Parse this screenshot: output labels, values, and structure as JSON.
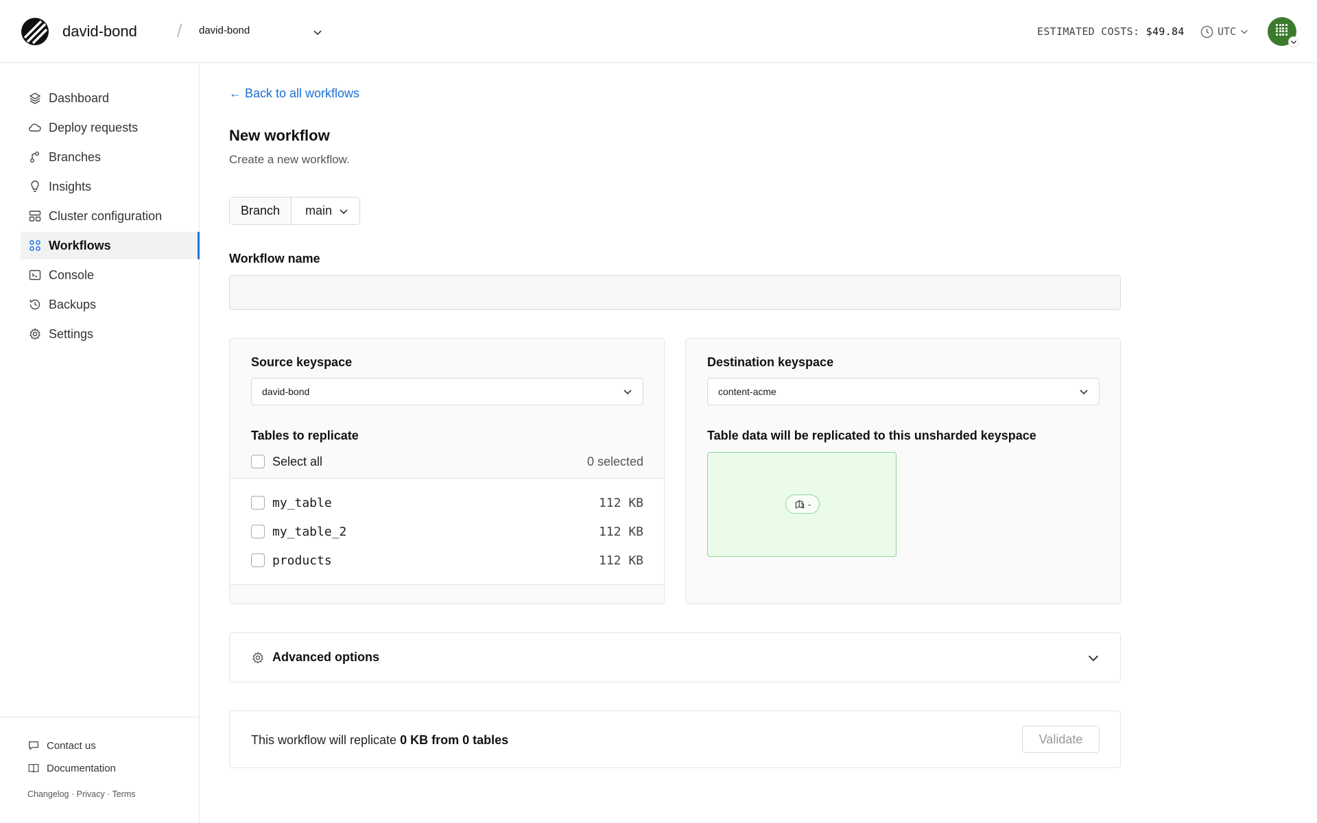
{
  "header": {
    "org_name": "david-bond",
    "database": "david-bond",
    "costs_label": "ESTIMATED COSTS:",
    "costs_value": "$49.84",
    "timezone": "UTC"
  },
  "sidebar": {
    "items": [
      {
        "label": "Dashboard",
        "icon": "layers-icon"
      },
      {
        "label": "Deploy requests",
        "icon": "cloud-icon"
      },
      {
        "label": "Branches",
        "icon": "branch-icon"
      },
      {
        "label": "Insights",
        "icon": "lightbulb-icon"
      },
      {
        "label": "Cluster configuration",
        "icon": "cluster-icon"
      },
      {
        "label": "Workflows",
        "icon": "workflows-icon",
        "active": true
      },
      {
        "label": "Console",
        "icon": "terminal-icon"
      },
      {
        "label": "Backups",
        "icon": "history-icon"
      },
      {
        "label": "Settings",
        "icon": "gear-icon"
      }
    ],
    "footer": {
      "contact": "Contact us",
      "docs": "Documentation",
      "changelog": "Changelog",
      "privacy": "Privacy",
      "terms": "Terms",
      "separator": "·"
    }
  },
  "main": {
    "back_link": "← Back to all workflows",
    "title": "New workflow",
    "subtitle": "Create a new workflow.",
    "branch_label": "Branch",
    "branch_value": "main",
    "workflow_name_label": "Workflow name",
    "workflow_name_value": "",
    "source": {
      "label": "Source keyspace",
      "value": "david-bond",
      "tables_label": "Tables to replicate",
      "select_all": "Select all",
      "selected_count": "0 selected",
      "tables": [
        {
          "name": "my_table",
          "size": "112 KB"
        },
        {
          "name": "my_table_2",
          "size": "112 KB"
        },
        {
          "name": "products",
          "size": "112 KB"
        }
      ]
    },
    "destination": {
      "label": "Destination keyspace",
      "value": "content-acme",
      "note": "Table data will be replicated to this unsharded keyspace",
      "shard_label": "-"
    },
    "advanced_label": "Advanced options",
    "summary": {
      "prefix": "This workflow will replicate ",
      "amount": "0 KB from 0 tables",
      "validate": "Validate"
    }
  }
}
